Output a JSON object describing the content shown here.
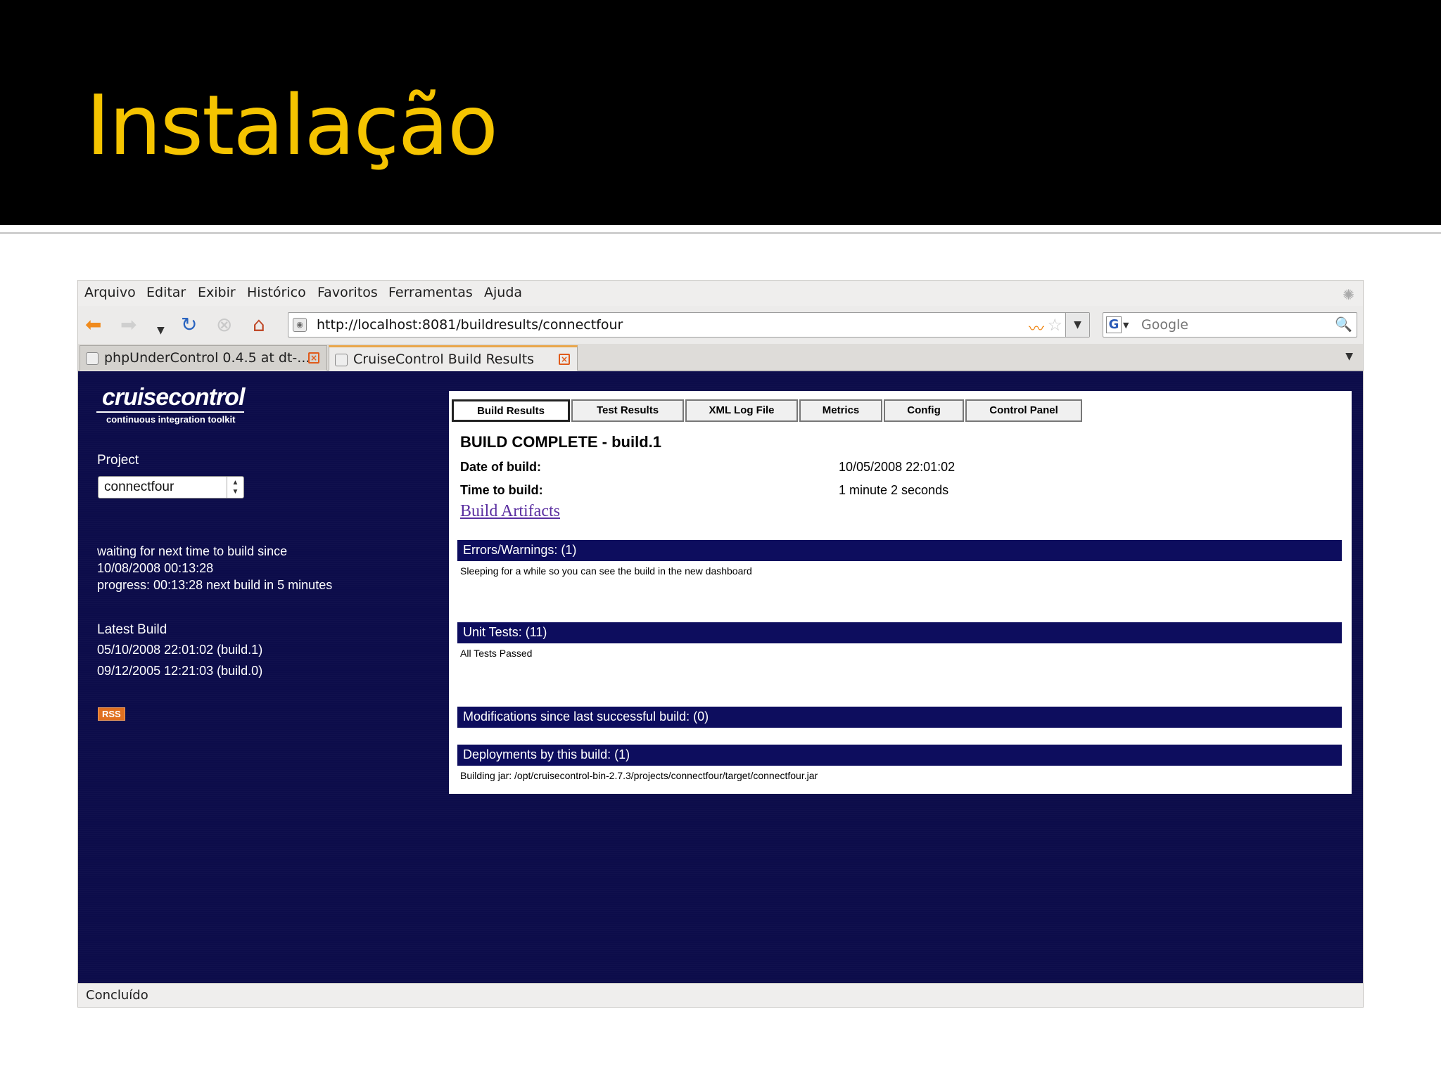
{
  "slide": {
    "title": "Instalação"
  },
  "browser": {
    "menu": [
      "Arquivo",
      "Editar",
      "Exibir",
      "Histórico",
      "Favoritos",
      "Ferramentas",
      "Ajuda"
    ],
    "url": "http://localhost:8081/buildresults/connectfour",
    "search_placeholder": "Google",
    "tabs": [
      {
        "label": "phpUnderControl 0.4.5 at dt-..."
      },
      {
        "label": "CruiseControl Build Results"
      }
    ],
    "status": "Concluído"
  },
  "page": {
    "logo": {
      "word": "cruisecontrol",
      "tagline": "continuous integration toolkit"
    },
    "project_label": "Project",
    "project_value": "connectfour",
    "status_lines": [
      "waiting for next time to build since",
      "10/08/2008 00:13:28",
      "progress: 00:13:28 next build in 5 minutes"
    ],
    "latest_label": "Latest Build",
    "latest_builds": [
      "05/10/2008 22:01:02 (build.1)",
      "09/12/2005 12:21:03 (build.0)"
    ],
    "rss": "RSS",
    "panel": {
      "tabs": [
        "Build Results",
        "Test Results",
        "XML Log File",
        "Metrics",
        "Config",
        "Control Panel"
      ],
      "build_title": "BUILD COMPLETE -  build.1",
      "date_label": "Date of build:",
      "date_value": "10/05/2008 22:01:02",
      "time_label": "Time to build:",
      "time_value": "1 minute 2 seconds",
      "artifacts": "Build Artifacts",
      "errors_header": "Errors/Warnings: (1)",
      "errors_text": "Sleeping for a while so you can see the build in the new dashboard",
      "tests_header": "Unit Tests: (11)",
      "tests_text": "All Tests Passed",
      "mods_header": "Modifications since last successful build:  (0)",
      "deploy_header": "Deployments by this build: (1)",
      "deploy_text": "Building jar: /opt/cruisecontrol-bin-2.7.3/projects/connectfour/target/connectfour.jar"
    }
  },
  "colors": {
    "slide_title": "#f5c400",
    "page_background": "#0c0c4a",
    "section_bar": "#0d0d5e",
    "link": "#5a2ea0"
  }
}
